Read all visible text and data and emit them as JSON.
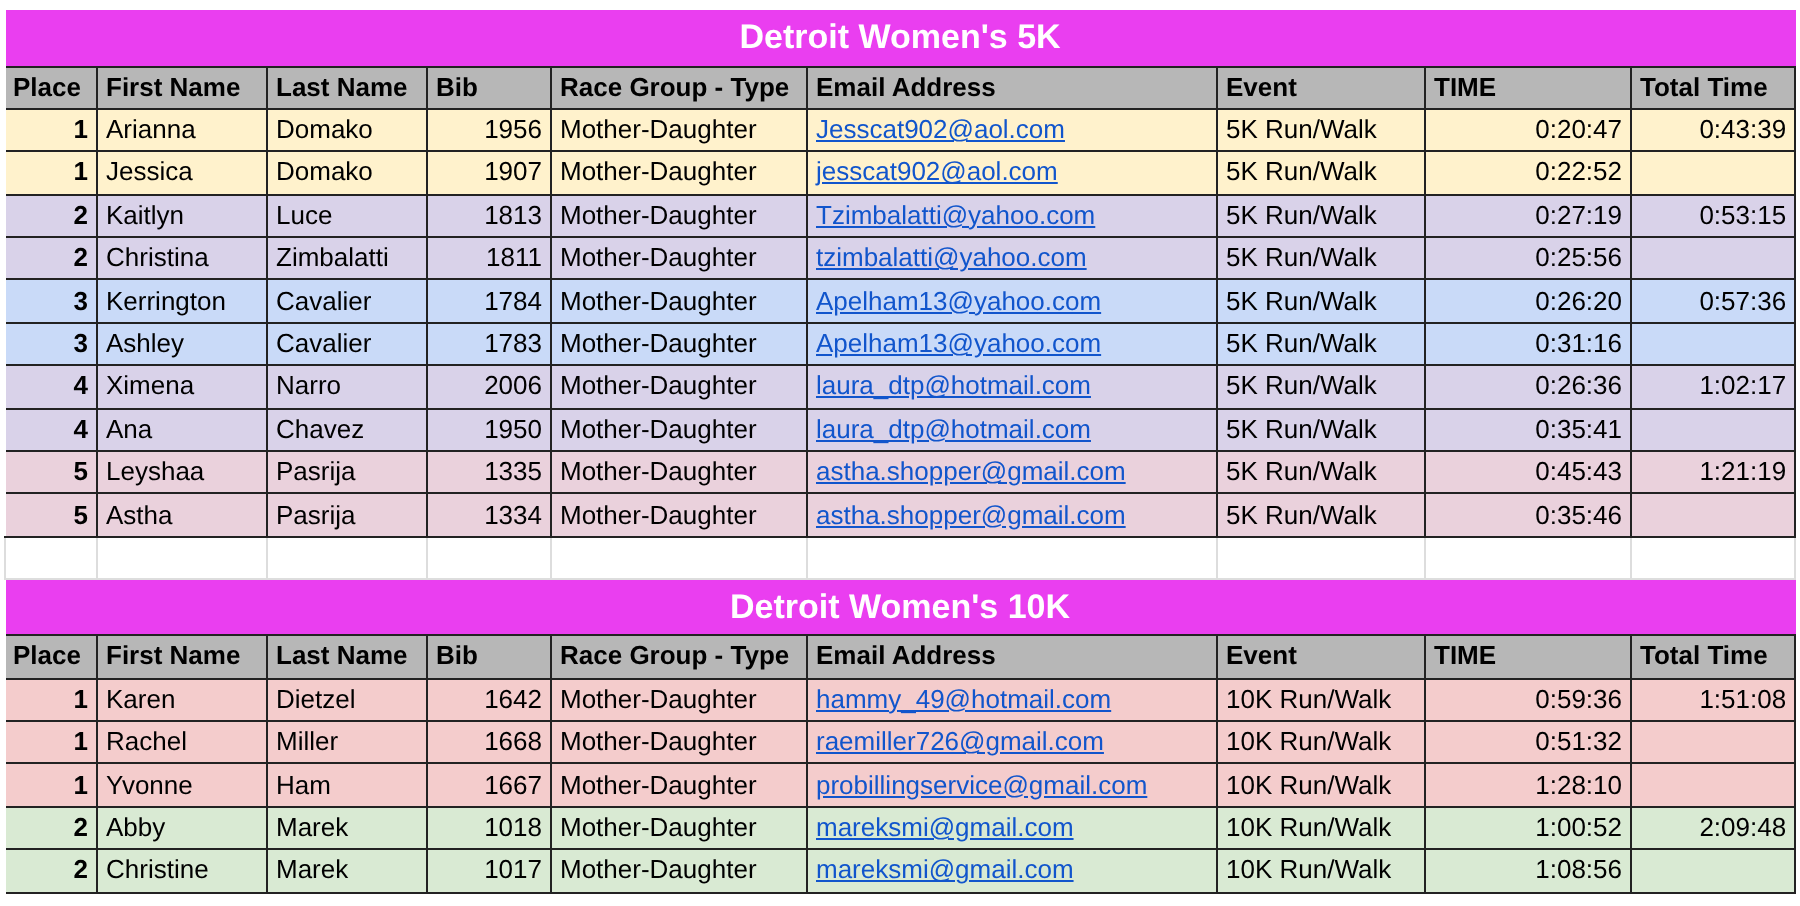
{
  "sections": [
    {
      "title": "Detroit Women's 5K",
      "columns": [
        "Place",
        "First Name",
        "Last Name",
        "Bib",
        "Race Group - Type",
        "Email Address",
        "Event",
        "TIME",
        "Total Time"
      ],
      "rows": [
        {
          "color": "#fff2cc",
          "cells": [
            "1",
            "Arianna",
            "Domako",
            "1956",
            "Mother-Daughter",
            "Jesscat902@aol.com",
            "5K Run/Walk",
            "0:20:47",
            "0:43:39"
          ]
        },
        {
          "color": "#fff2cc",
          "cells": [
            "1",
            "Jessica",
            "Domako",
            "1907",
            "Mother-Daughter",
            "jesscat902@aol.com",
            "5K Run/Walk",
            "0:22:52",
            ""
          ]
        },
        {
          "color": "#d9d2e9",
          "cells": [
            "2",
            "Kaitlyn",
            "Luce",
            "1813",
            "Mother-Daughter",
            "Tzimbalatti@yahoo.com",
            "5K Run/Walk",
            "0:27:19",
            "0:53:15"
          ]
        },
        {
          "color": "#d9d2e9",
          "cells": [
            "2",
            "Christina",
            "Zimbalatti",
            "1811",
            "Mother-Daughter",
            "tzimbalatti@yahoo.com",
            "5K Run/Walk",
            "0:25:56",
            ""
          ]
        },
        {
          "color": "#c9daf8",
          "cells": [
            "3",
            "Kerrington",
            "Cavalier",
            "1784",
            "Mother-Daughter",
            "Apelham13@yahoo.com",
            "5K Run/Walk",
            "0:26:20",
            "0:57:36"
          ]
        },
        {
          "color": "#c9daf8",
          "cells": [
            "3",
            "Ashley",
            "Cavalier",
            "1783",
            "Mother-Daughter",
            "Apelham13@yahoo.com",
            "5K Run/Walk",
            "0:31:16",
            ""
          ]
        },
        {
          "color": "#d9d2e9",
          "cells": [
            "4",
            "Ximena",
            "Narro",
            "2006",
            "Mother-Daughter",
            "laura_dtp@hotmail.com",
            "5K Run/Walk",
            "0:26:36",
            "1:02:17"
          ]
        },
        {
          "color": "#d9d2e9",
          "cells": [
            "4",
            "Ana",
            "Chavez",
            "1950",
            "Mother-Daughter",
            "laura_dtp@hotmail.com",
            "5K Run/Walk",
            "0:35:41",
            ""
          ]
        },
        {
          "color": "#ead1dc",
          "cells": [
            "5",
            "Leyshaa",
            "Pasrija",
            "1335",
            "Mother-Daughter",
            "astha.shopper@gmail.com",
            "5K Run/Walk",
            "0:45:43",
            "1:21:19"
          ]
        },
        {
          "color": "#ead1dc",
          "cells": [
            "5",
            "Astha",
            "Pasrija",
            "1334",
            "Mother-Daughter",
            "astha.shopper@gmail.com",
            "5K Run/Walk",
            "0:35:46",
            ""
          ]
        }
      ]
    },
    {
      "title": "Detroit Women's 10K",
      "columns": [
        "Place",
        "First Name",
        "Last Name",
        "Bib",
        "Race Group - Type",
        "Email Address",
        "Event",
        "TIME",
        "Total Time"
      ],
      "rows": [
        {
          "color": "#f4cccc",
          "cells": [
            "1",
            "Karen",
            "Dietzel",
            "1642",
            "Mother-Daughter",
            "hammy_49@hotmail.com",
            "10K Run/Walk",
            "0:59:36",
            "1:51:08"
          ]
        },
        {
          "color": "#f4cccc",
          "cells": [
            "1",
            "Rachel",
            "Miller",
            "1668",
            "Mother-Daughter",
            "raemiller726@gmail.com",
            "10K Run/Walk",
            "0:51:32",
            ""
          ]
        },
        {
          "color": "#f4cccc",
          "cells": [
            "1",
            "Yvonne",
            "Ham",
            "1667",
            "Mother-Daughter",
            "probillingservice@gmail.com",
            "10K Run/Walk",
            "1:28:10",
            ""
          ]
        },
        {
          "color": "#d9ead3",
          "cells": [
            "2",
            "Abby",
            "Marek",
            "1018",
            "Mother-Daughter",
            "mareksmi@gmail.com",
            "10K Run/Walk",
            "1:00:52",
            "2:09:48"
          ]
        },
        {
          "color": "#d9ead3",
          "cells": [
            "2",
            "Christine",
            "Marek",
            "1017",
            "Mother-Daughter",
            "mareksmi@gmail.com",
            "10K Run/Walk",
            "1:08:56",
            ""
          ]
        }
      ]
    }
  ]
}
